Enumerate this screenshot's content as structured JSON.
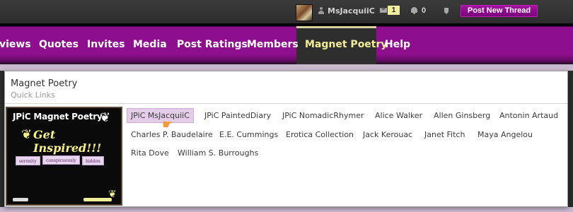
{
  "userbar": {
    "username": "MsJacquiiC",
    "conversations_count": "1",
    "alerts_count": "0",
    "post_button_label": "Post New Thread"
  },
  "nav": {
    "items": [
      {
        "label": "views"
      },
      {
        "label": "Quotes"
      },
      {
        "label": "Invites"
      },
      {
        "label": "Media"
      },
      {
        "label": "Post Ratings"
      },
      {
        "label": "Members"
      },
      {
        "label": "Magnet Poetry",
        "active": true
      },
      {
        "label": "Help"
      }
    ]
  },
  "panel": {
    "title": "Magnet Poetry",
    "subtitle": "Quick Links",
    "forum_image": {
      "title": "JPiC Magnet Poetry",
      "tagline": "Get Inspired!!!",
      "words": [
        "serenity",
        "conspicuously",
        "hidden"
      ]
    },
    "links": [
      {
        "label": "JPiC MsJacquiiC",
        "hovered": true
      },
      {
        "label": "JPiC PaintedDiary"
      },
      {
        "label": "JPiC NomadicRhymer"
      },
      {
        "label": "Alice Walker"
      },
      {
        "label": "Allen Ginsberg"
      },
      {
        "label": "Antonin Artaud"
      },
      {
        "label": "Charles P. Baudelaire"
      },
      {
        "label": "E.E. Cummings"
      },
      {
        "label": "Erotica Collection"
      },
      {
        "label": "Jack Kerouac"
      },
      {
        "label": "Janet Fitch"
      },
      {
        "label": "Maya Angelou"
      },
      {
        "label": "Rita Dove"
      },
      {
        "label": "William S. Burroughs"
      }
    ]
  },
  "colors": {
    "nav_purple": "#8d0f8d",
    "active_tab_text": "#f4ee9a",
    "button_purple": "#8a0a8a",
    "link_hover_bg": "#e4cde8"
  },
  "icons": [
    "user-icon",
    "mail-icon",
    "bell-icon",
    "bookmark-icon",
    "hand-cursor-icon",
    "butterfly-icon"
  ]
}
